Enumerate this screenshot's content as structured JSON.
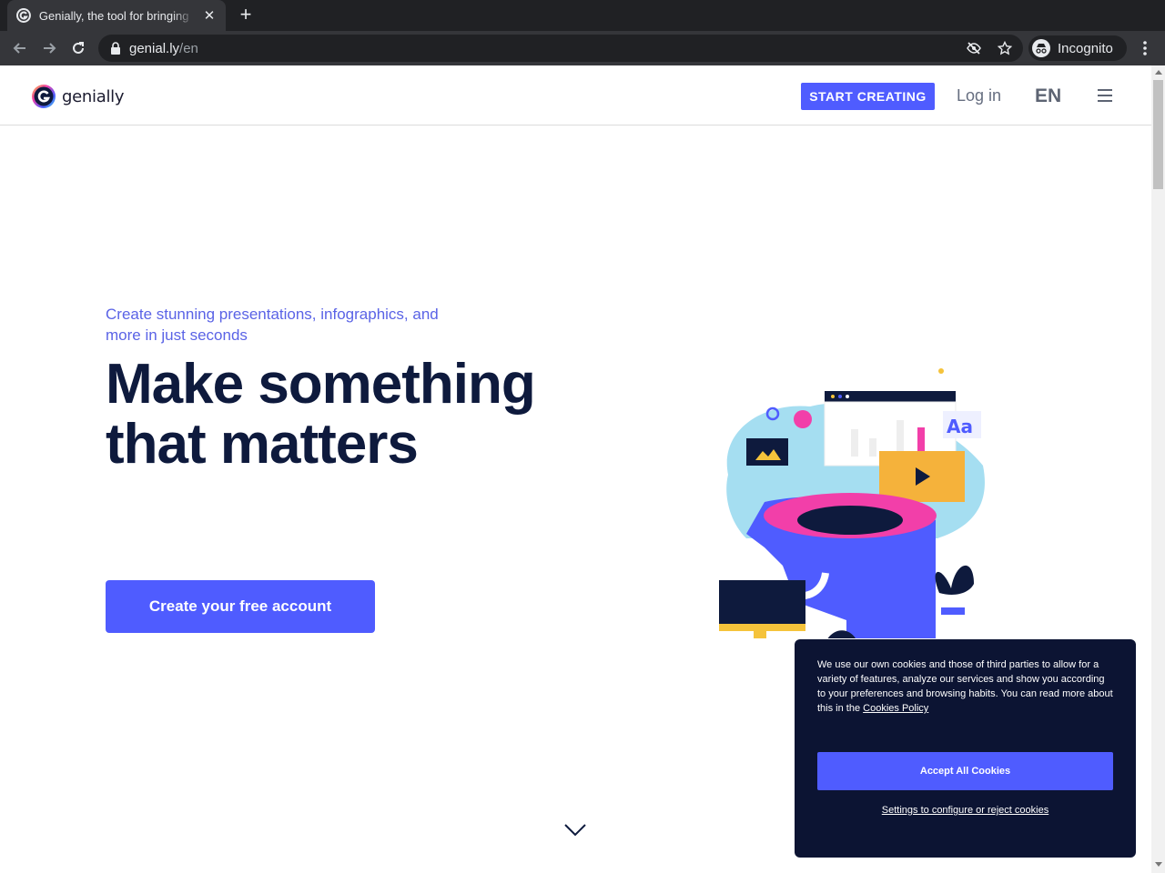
{
  "browser": {
    "tab_title": "Genially, the tool for bringing",
    "url_domain": "genial.ly",
    "url_path": "/en",
    "incognito_label": "Incognito",
    "icons": [
      "back-icon",
      "forward-icon",
      "reload-icon",
      "lock-icon",
      "eye-off-icon",
      "star-icon",
      "incognito-icon",
      "kebab-menu-icon"
    ]
  },
  "header": {
    "logo_text": "genially",
    "start_button": "START CREATING",
    "login": "Log in",
    "language": "EN"
  },
  "hero": {
    "subtitle": "Create stunning presentations, infographics, and more in just seconds",
    "headline_line1": "Make something",
    "headline_line2": "that matters",
    "cta": "Create your free account",
    "illustration_label": "Aa"
  },
  "cookie_banner": {
    "text": "We use our own cookies and those of third parties to allow for a variety of features, analyze our services and show you according to your preferences and browsing habits. You can read more about this in the ",
    "policy_link": "Cookies Policy",
    "accept": "Accept All Cookies",
    "settings": "Settings to configure or reject cookies"
  },
  "colors": {
    "brand_blue": "#4f5cff",
    "headline": "#0e1a3d",
    "banner_bg": "#0c1433",
    "accent_pink": "#f23fa9",
    "accent_yellow": "#f5c33b"
  }
}
